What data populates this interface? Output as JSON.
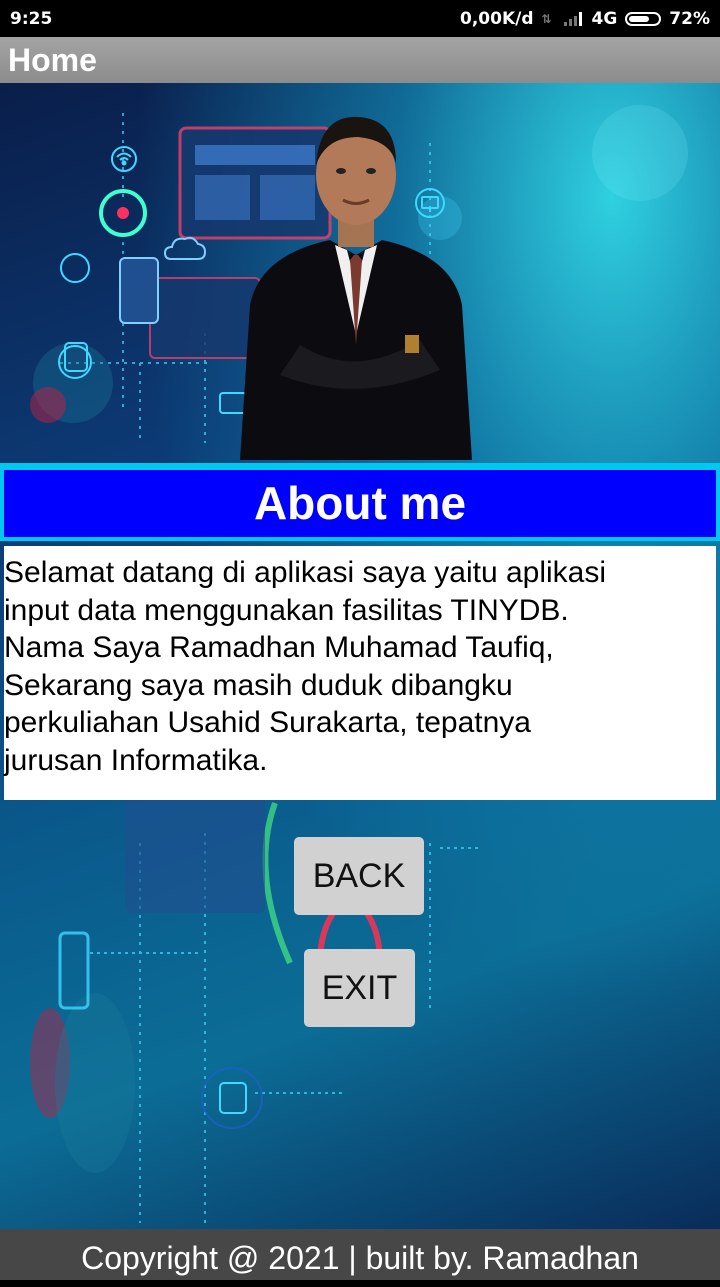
{
  "status_bar": {
    "time": "9:25",
    "net_speed": "0,00K/d",
    "network_type": "4G",
    "battery_percent": "72%",
    "battery_level": 0.72
  },
  "app_bar": {
    "title": "Home"
  },
  "about": {
    "heading": "About me",
    "text_lines": [
      "Selamat datang di aplikasi saya yaitu aplikasi",
      "input data menggunakan fasilitas TINYDB.",
      "Nama Saya Ramadhan Muhamad Taufiq,",
      "Sekarang saya masih duduk dibangku",
      "perkuliahan Usahid Surakarta, tepatnya",
      "jurusan Informatika."
    ]
  },
  "buttons": {
    "back": "BACK",
    "exit": "EXIT"
  },
  "footer": {
    "text": "Copyright @ 2021 | built by. Ramadhan"
  },
  "colors": {
    "heading_bar": "#0000ff",
    "heading_border": "#00c8f0",
    "button_bg": "#d1d1d1",
    "footer_bg": "#474747",
    "titlebar_bg": "#999999"
  },
  "icons": [
    "wifi-icon",
    "monitor-icon",
    "cloud-icon",
    "smartphone-icon",
    "signal-icon",
    "battery-icon"
  ]
}
